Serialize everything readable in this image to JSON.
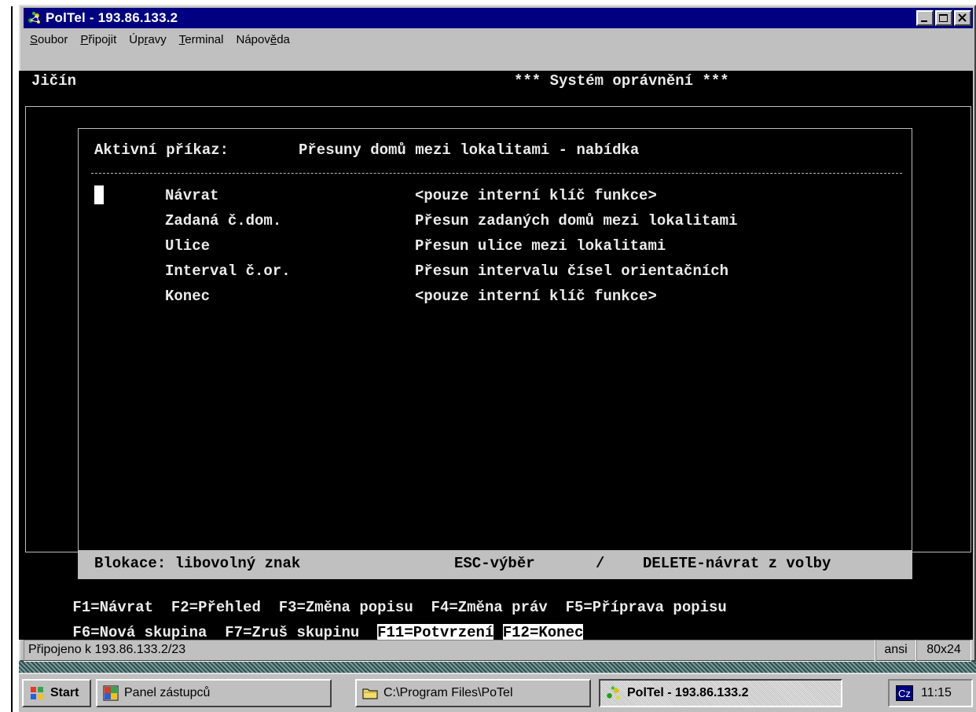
{
  "window": {
    "title": "PolTel - 193.86.133.2",
    "controls": [
      "minimize",
      "maximize",
      "close"
    ]
  },
  "menu": [
    {
      "label": "Soubor",
      "accel_index": 0
    },
    {
      "label": "Připojit",
      "accel_index": 0
    },
    {
      "label": "Úpravy",
      "accel_index": 2
    },
    {
      "label": "Terminal",
      "accel_index": 0
    },
    {
      "label": "Nápověda",
      "accel_index": 5
    }
  ],
  "terminal": {
    "location": "Jičín",
    "system_title": "*** Systém oprávnění ***",
    "active_command_label": "Aktivní příkaz:",
    "active_command": "Přesuny domů mezi lokalitami - nabídka",
    "items": [
      {
        "name": "Návrat",
        "description": "<pouze interní klíč funkce>"
      },
      {
        "name": "Zadaná č.dom.",
        "description": "Přesun zadaných domů mezi lokalitami"
      },
      {
        "name": "Ulice",
        "description": "Přesun ulice mezi lokalitami"
      },
      {
        "name": "Interval č.or.",
        "description": "Přesun intervalu čísel orientačních"
      },
      {
        "name": "Konec",
        "description": "<pouze interní klíč funkce>"
      }
    ],
    "status": {
      "blocking": "Blokace: libovolný znak",
      "esc": "ESC-výběr",
      "slash": "/",
      "delete": "DELETE-návrat z volby"
    },
    "fkeys_row1": [
      "F1=Návrat",
      "F2=Přehled",
      "F3=Změna popisu",
      "F4=Změna práv",
      "F5=Příprava popisu"
    ],
    "fkeys_row2": [
      "F6=Nová skupina",
      "F7=Zruš skupinu",
      "F11=Potvrzení",
      "F12=Konec"
    ]
  },
  "statusbar": {
    "connection": "Připojeno k 193.86.133.2/23",
    "emulation": "ansi",
    "size": "80x24"
  },
  "taskbar": {
    "start": "Start",
    "buttons": [
      "Panel zástupců",
      "C:\\Program Files\\PoTel",
      "PolTel - 193.86.133.2"
    ],
    "active_button": "PolTel - 193.86.133.2",
    "language": "Cz",
    "clock": "11:15"
  }
}
